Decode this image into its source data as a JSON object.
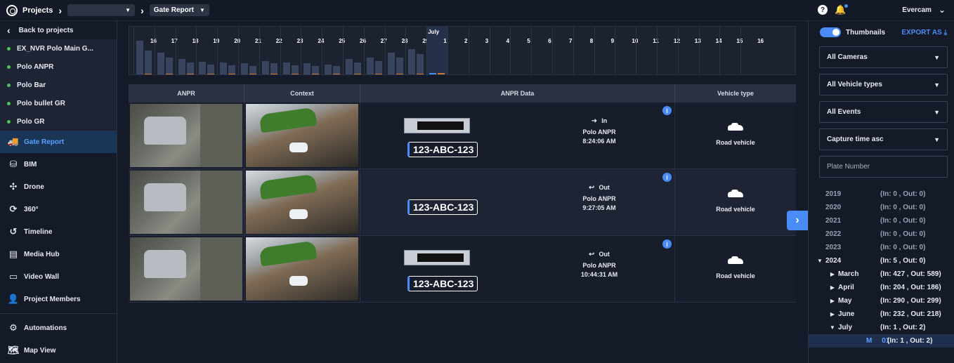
{
  "header": {
    "projects": "Projects",
    "project_dropdown": "",
    "page": "Gate Report",
    "user": "Evercam"
  },
  "sidebar": {
    "back": "Back to projects",
    "cameras": [
      "EX_NVR Polo Main G...",
      "Polo ANPR",
      "Polo Bar",
      "Polo bullet GR",
      "Polo GR"
    ],
    "nav": [
      {
        "label": "Gate Report",
        "icon": "truck-icon"
      },
      {
        "label": "BIM",
        "icon": "bim-icon"
      },
      {
        "label": "Drone",
        "icon": "drone-icon"
      },
      {
        "label": "360°",
        "icon": "360-icon"
      },
      {
        "label": "Timeline",
        "icon": "history-icon"
      },
      {
        "label": "Media Hub",
        "icon": "media-icon"
      },
      {
        "label": "Video Wall",
        "icon": "monitor-icon"
      },
      {
        "label": "Project Members",
        "icon": "add-user-icon"
      }
    ],
    "nav2": [
      {
        "label": "Automations",
        "icon": "automation-icon"
      },
      {
        "label": "Map View",
        "icon": "map-icon"
      }
    ]
  },
  "timeline": {
    "month": "July",
    "days": [
      "16",
      "17",
      "18",
      "19",
      "20",
      "21",
      "22",
      "23",
      "24",
      "25",
      "26",
      "27",
      "28",
      "29",
      "1",
      "2",
      "3",
      "4",
      "5",
      "6",
      "7",
      "8",
      "9",
      "10",
      "11",
      "12",
      "13",
      "14",
      "15",
      "16"
    ],
    "in_counts": [
      40,
      26,
      18,
      15,
      14,
      13,
      16,
      14,
      13,
      12,
      18,
      20,
      26,
      30,
      1,
      0,
      0,
      0,
      0,
      0,
      0,
      0,
      0,
      0,
      0,
      0,
      0,
      0,
      0,
      0
    ],
    "out_counts": [
      28,
      20,
      14,
      12,
      11,
      10,
      13,
      11,
      10,
      10,
      14,
      16,
      20,
      24,
      2,
      0,
      0,
      0,
      0,
      0,
      0,
      0,
      0,
      0,
      0,
      0,
      0,
      0,
      0,
      0
    ]
  },
  "table": {
    "headers": [
      "ANPR",
      "Context",
      "ANPR Data",
      "Vehicle type"
    ],
    "rows": [
      {
        "plate": "123-ABC-123",
        "direction": "In",
        "camera": "Polo ANPR",
        "time": "8:24:06 AM",
        "vehicle": "Road vehicle",
        "has_plate_img": true
      },
      {
        "plate": "123-ABC-123",
        "direction": "Out",
        "camera": "Polo ANPR",
        "time": "9:27:05 AM",
        "vehicle": "Road vehicle",
        "has_plate_img": false
      },
      {
        "plate": "123-ABC-123",
        "direction": "Out",
        "camera": "Polo ANPR",
        "time": "10:44:31 AM",
        "vehicle": "Road vehicle",
        "has_plate_img": true
      }
    ]
  },
  "right": {
    "thumbnails": "Thumbnails",
    "export": "EXPORT AS",
    "filters": [
      "All Cameras",
      "All Vehicle types",
      "All Events",
      "Capture time asc"
    ],
    "plate_placeholder": "Plate Number",
    "tree": [
      {
        "name": "2019",
        "count": "(In: 0 , Out: 0)",
        "level": 0,
        "muted": true,
        "tri": ""
      },
      {
        "name": "2020",
        "count": "(In: 0 , Out: 0)",
        "level": 0,
        "muted": true,
        "tri": ""
      },
      {
        "name": "2021",
        "count": "(In: 0 , Out: 0)",
        "level": 0,
        "muted": true,
        "tri": ""
      },
      {
        "name": "2022",
        "count": "(In: 0 , Out: 0)",
        "level": 0,
        "muted": true,
        "tri": ""
      },
      {
        "name": "2023",
        "count": "(In: 0 , Out: 0)",
        "level": 0,
        "muted": true,
        "tri": ""
      },
      {
        "name": "2024",
        "count": "(In: 5 , Out: 0)",
        "level": 0,
        "muted": false,
        "tri": "▼"
      },
      {
        "name": "March",
        "count": "(In: 427 , Out: 589)",
        "level": 1,
        "muted": false,
        "tri": "▶"
      },
      {
        "name": "April",
        "count": "(In: 204 , Out: 186)",
        "level": 1,
        "muted": false,
        "tri": "▶"
      },
      {
        "name": "May",
        "count": "(In: 290 , Out: 299)",
        "level": 1,
        "muted": false,
        "tri": "▶"
      },
      {
        "name": "June",
        "count": "(In: 232 , Out: 218)",
        "level": 1,
        "muted": false,
        "tri": "▶"
      },
      {
        "name": "July",
        "count": "(In: 1 , Out: 2)",
        "level": 1,
        "muted": false,
        "tri": "▼"
      },
      {
        "name": "M     01",
        "count": "(In: 1 , Out: 2)",
        "level": 2,
        "muted": false,
        "tri": ""
      }
    ]
  }
}
